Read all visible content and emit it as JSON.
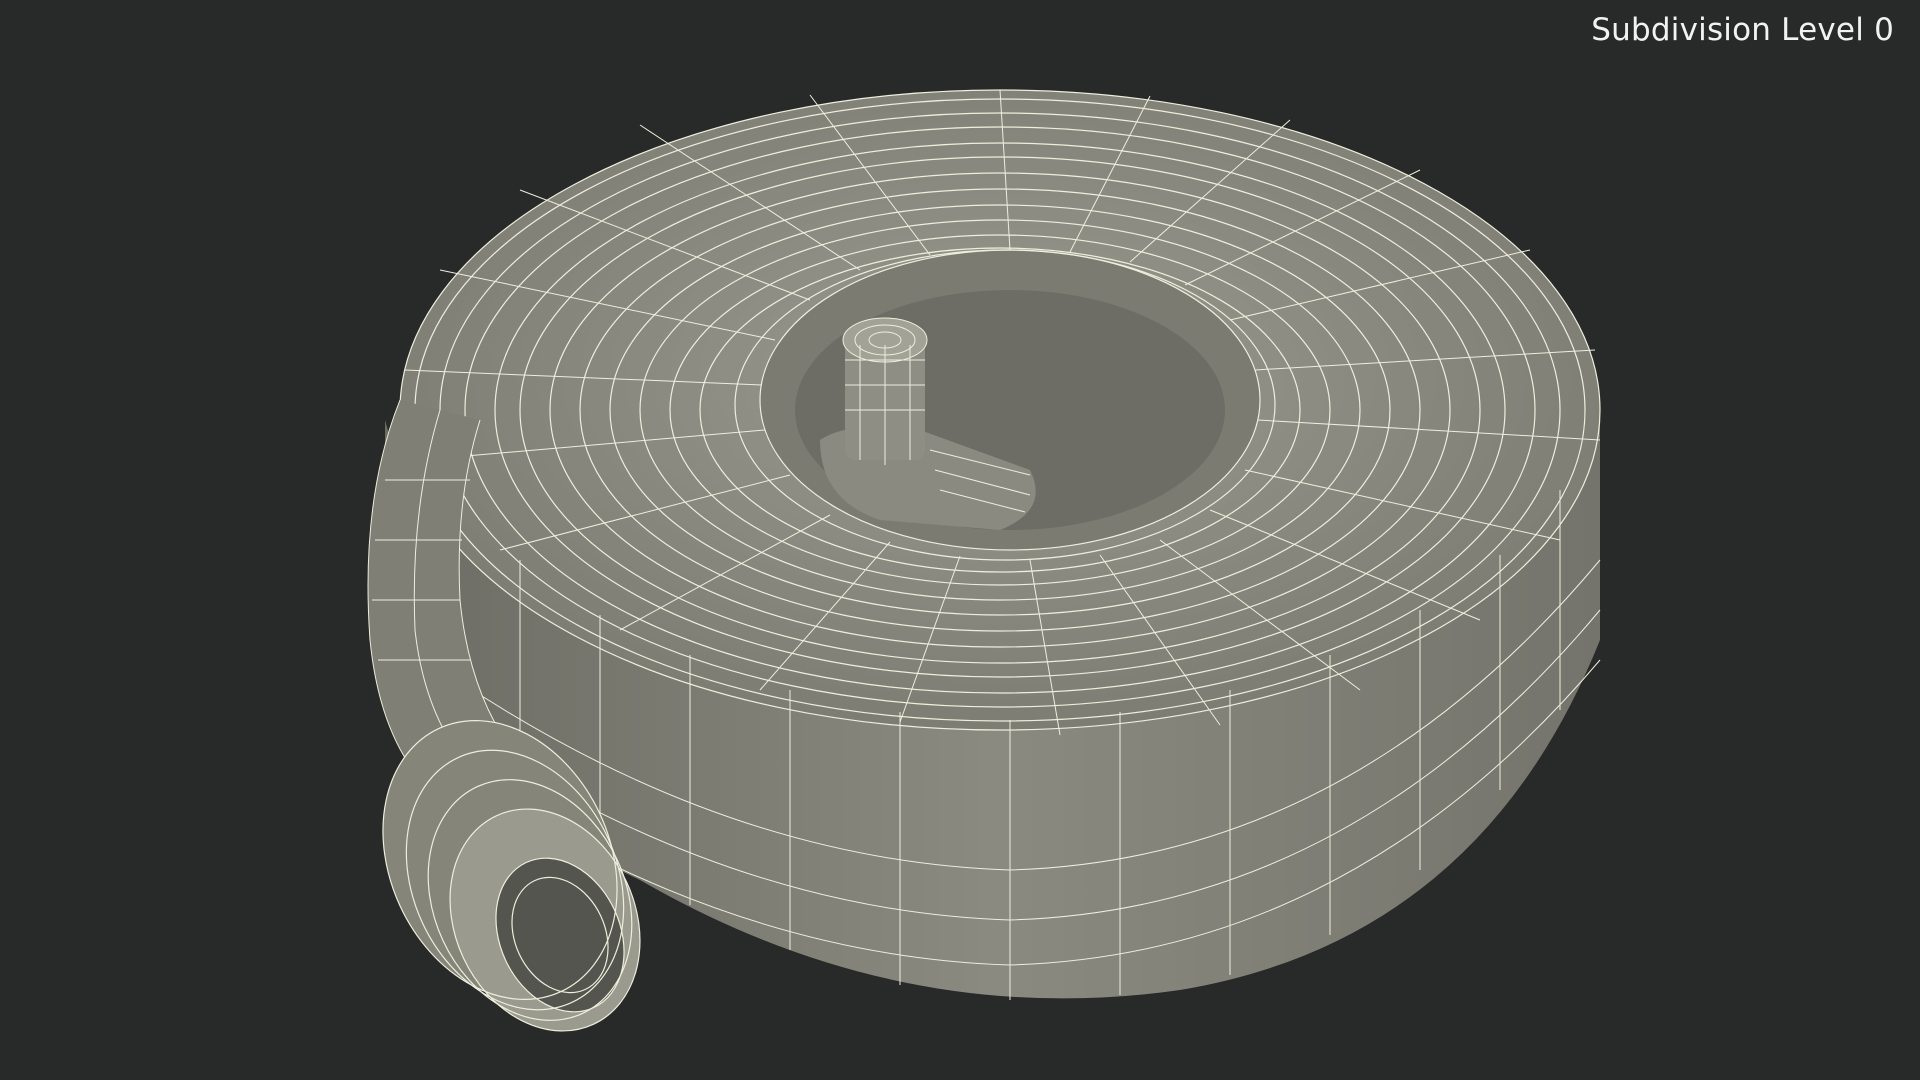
{
  "viewport": {
    "background_color": "#282929",
    "overlay_text": "Subdivision Level 0"
  },
  "model": {
    "subject": "coiled hose with couplings",
    "render_style": "wireframe over shaded mesh",
    "mesh_color": "#8d8d82",
    "wire_color": "#eeeedd"
  }
}
